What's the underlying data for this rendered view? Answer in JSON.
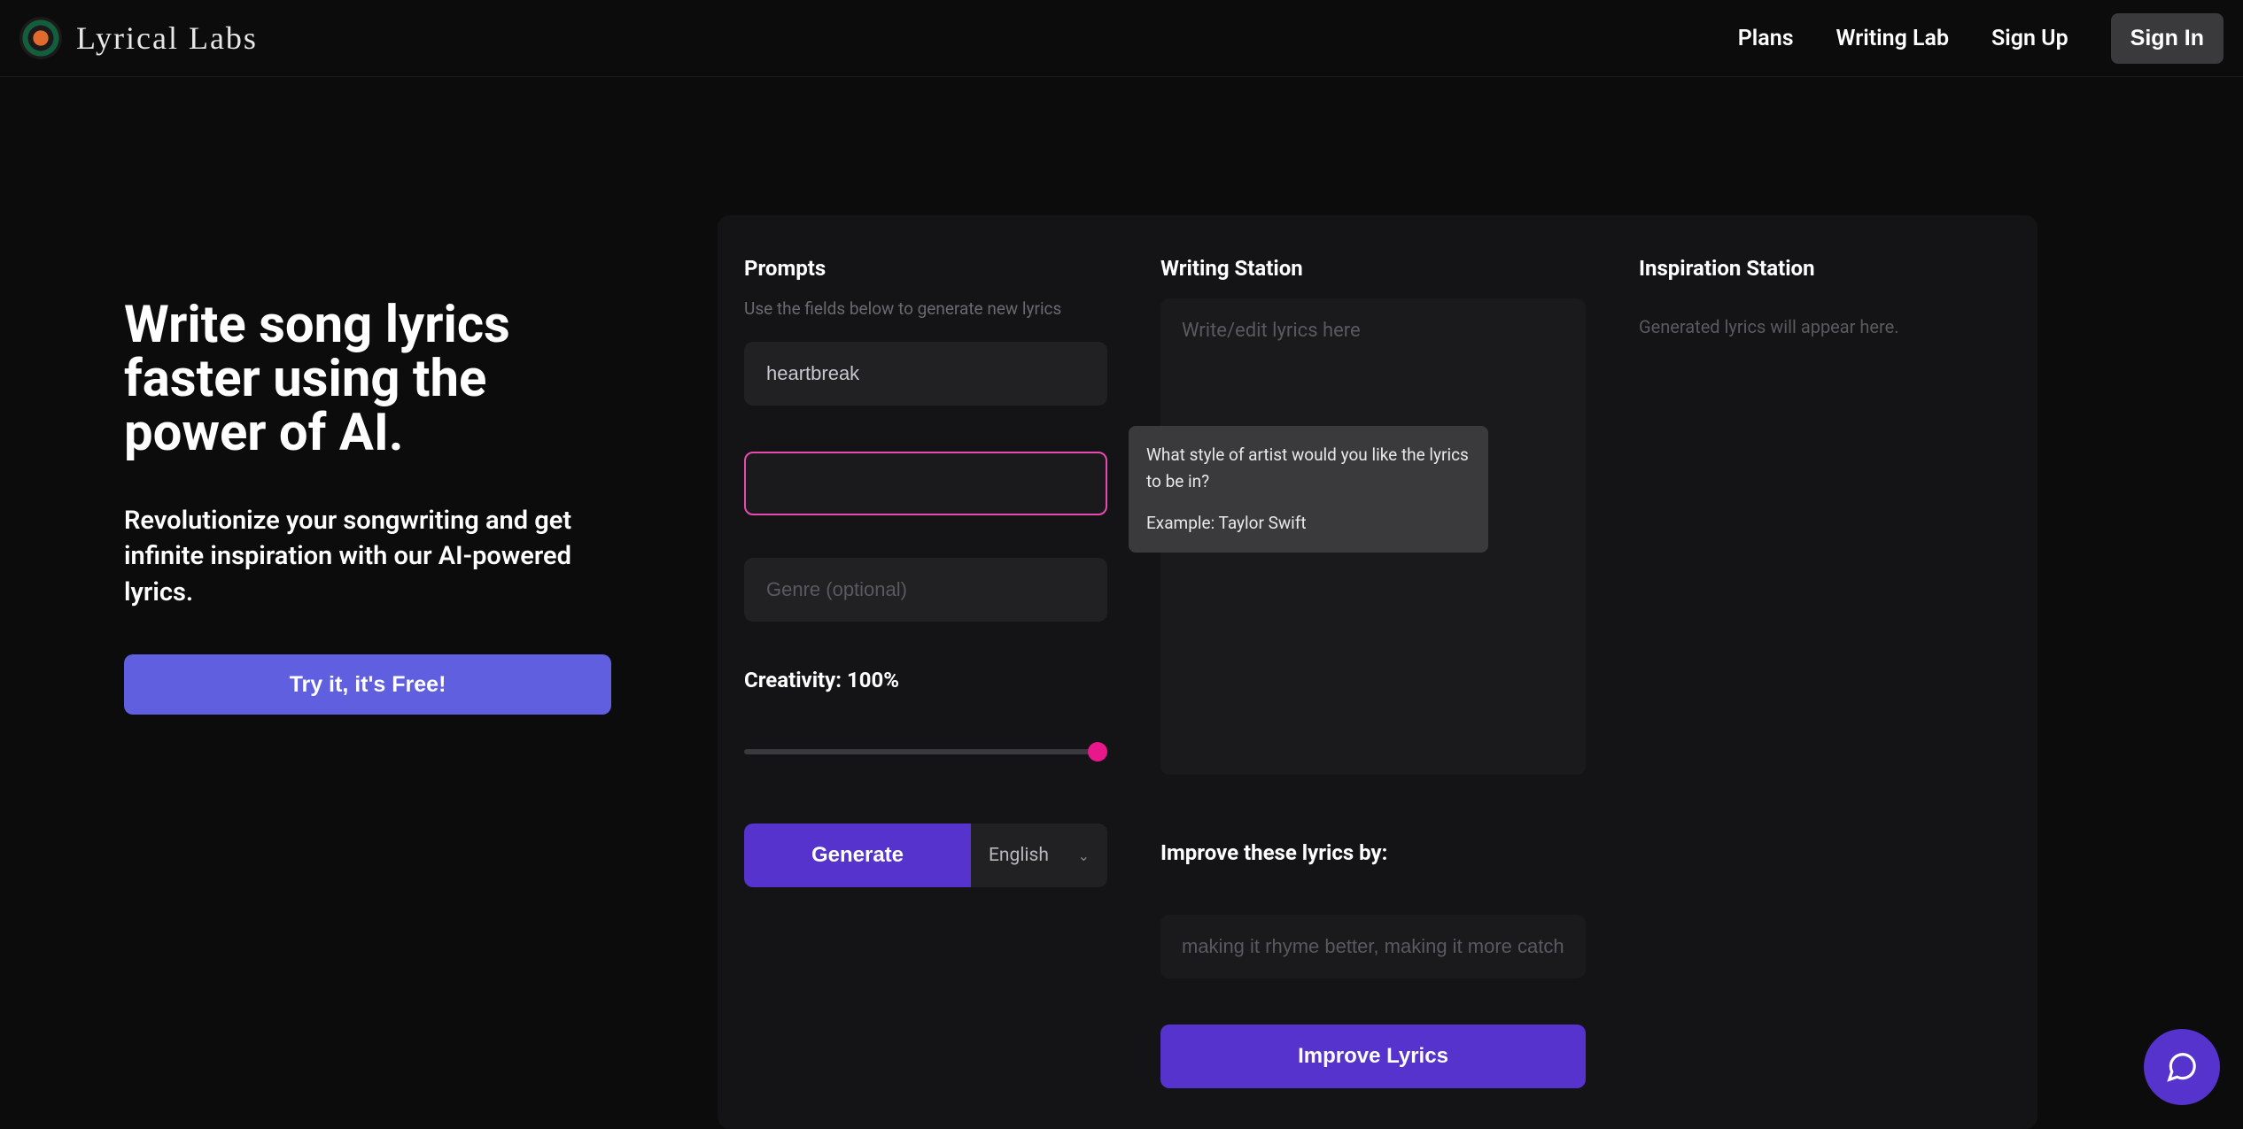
{
  "brand": "Lyrical Labs",
  "nav": {
    "plans": "Plans",
    "writing_lab": "Writing Lab",
    "sign_up": "Sign Up",
    "sign_in": "Sign In"
  },
  "hero": {
    "headline": "Write song lyrics faster using the power of AI.",
    "sub": "Revolutionize your songwriting and get infinite inspiration with our AI-powered lyrics.",
    "cta": "Try it, it's Free!"
  },
  "prompts": {
    "title": "Prompts",
    "hint": "Use the fields below to generate new lyrics",
    "topic_value": "heartbreak",
    "artist_value": "",
    "genre_placeholder": "Genre (optional)",
    "creativity_label": "Creativity: 100%",
    "creativity_value": 100,
    "generate_label": "Generate",
    "language": "English"
  },
  "tooltip": {
    "line1": "What style of artist would you like the lyrics to be in?",
    "line2": "Example: Taylor Swift"
  },
  "writing": {
    "title": "Writing Station",
    "lyrics_placeholder": "Write/edit lyrics here",
    "improve_label": "Improve these lyrics by:",
    "improve_placeholder": "making it rhyme better, making it more catchy, etc.",
    "improve_button": "Improve Lyrics"
  },
  "inspiration": {
    "title": "Inspiration Station",
    "placeholder": "Generated lyrics will appear here."
  }
}
